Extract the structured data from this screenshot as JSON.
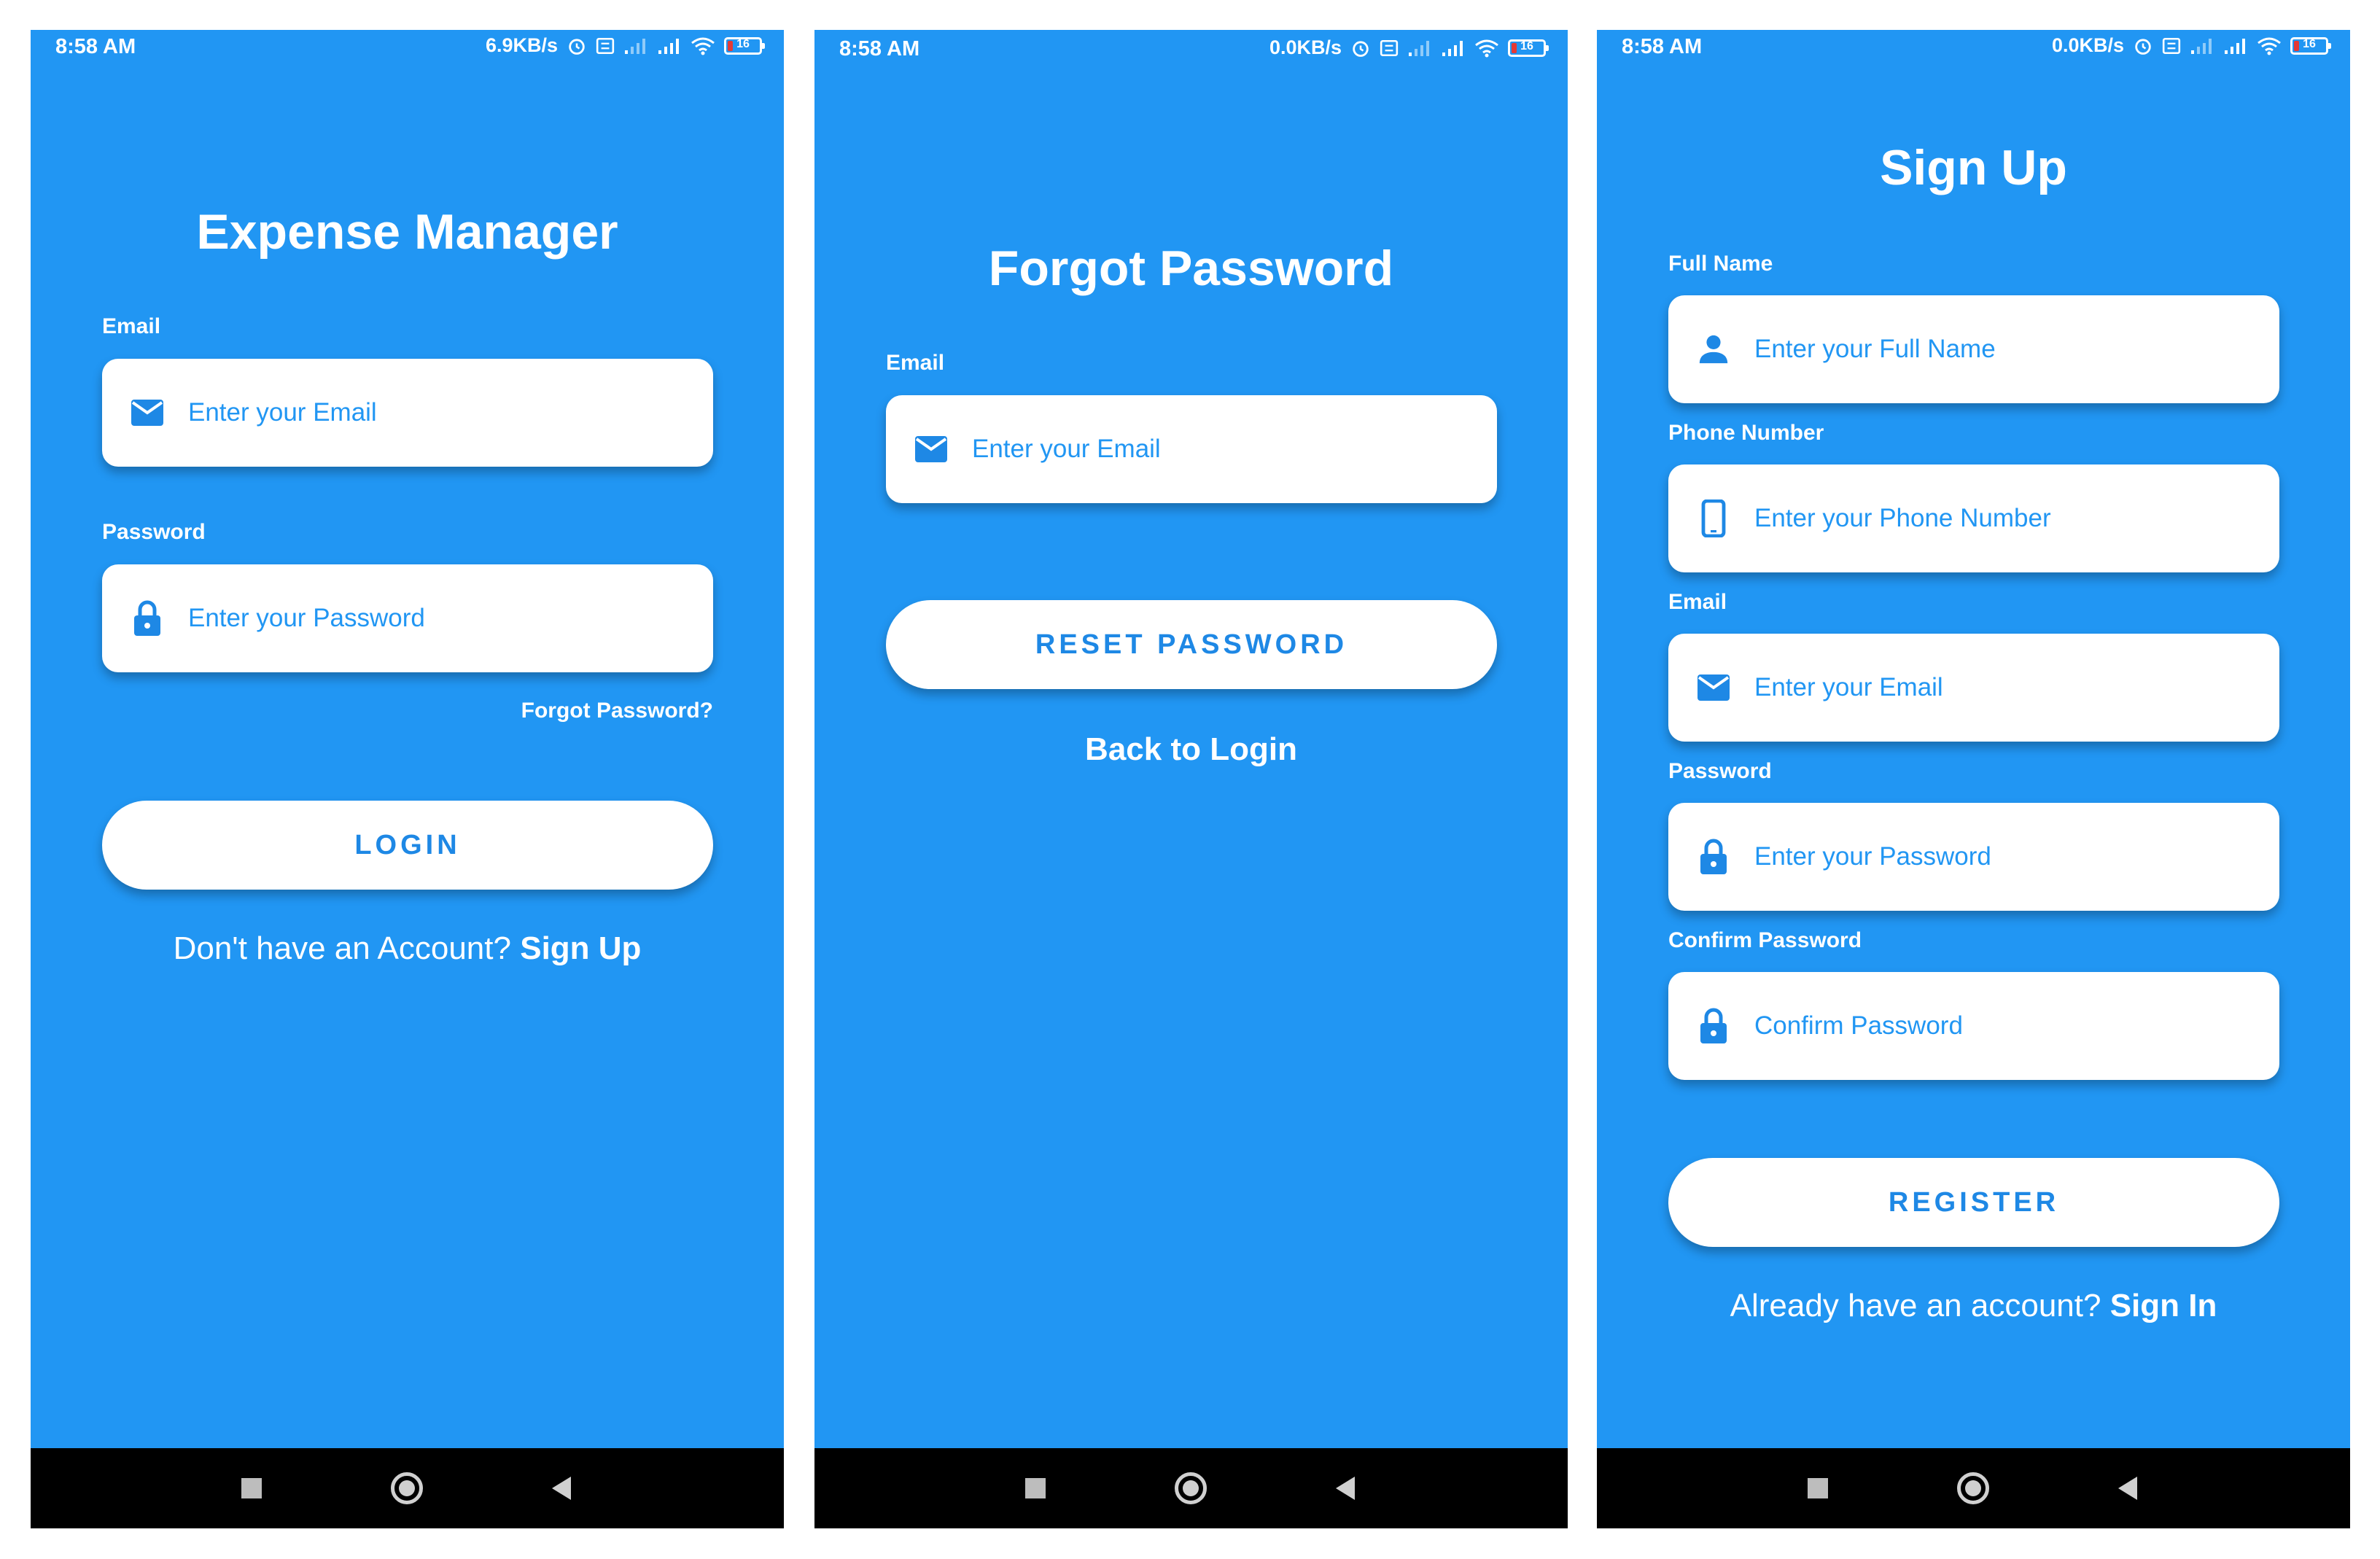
{
  "colors": {
    "background": "#2196f3",
    "accent": "#1e88e5",
    "card": "#ffffff",
    "navbar": "#000000"
  },
  "screens": [
    {
      "status": {
        "time": "8:58 AM",
        "speed": "6.9KB/s",
        "battery": "16"
      },
      "title": "Expense Manager",
      "fields": [
        {
          "label": "Email",
          "placeholder": "Enter your Email",
          "icon": "mail-icon"
        },
        {
          "label": "Password",
          "placeholder": "Enter your Password",
          "icon": "lock-icon"
        }
      ],
      "forgot_link": "Forgot Password?",
      "primary_button": "LOGIN",
      "footer_prompt": "Don't have an Account?",
      "footer_link": "Sign Up"
    },
    {
      "status": {
        "time": "8:58 AM",
        "speed": "0.0KB/s",
        "battery": "16"
      },
      "title": "Forgot Password",
      "fields": [
        {
          "label": "Email",
          "placeholder": "Enter your Email",
          "icon": "mail-icon"
        }
      ],
      "primary_button": "RESET PASSWORD",
      "footer_link": "Back to Login"
    },
    {
      "status": {
        "time": "8:58 AM",
        "speed": "0.0KB/s",
        "battery": "16"
      },
      "title": "Sign Up",
      "fields": [
        {
          "label": "Full Name",
          "placeholder": "Enter your Full Name",
          "icon": "person-icon"
        },
        {
          "label": "Phone Number",
          "placeholder": "Enter your Phone Number",
          "icon": "phone-icon"
        },
        {
          "label": "Email",
          "placeholder": "Enter your Email",
          "icon": "mail-icon"
        },
        {
          "label": "Password",
          "placeholder": "Enter your Password",
          "icon": "lock-icon"
        },
        {
          "label": "Confirm Password",
          "placeholder": "Confirm Password",
          "icon": "lock-icon"
        }
      ],
      "primary_button": "REGISTER",
      "footer_prompt": "Already have an account?",
      "footer_link": "Sign In"
    }
  ]
}
